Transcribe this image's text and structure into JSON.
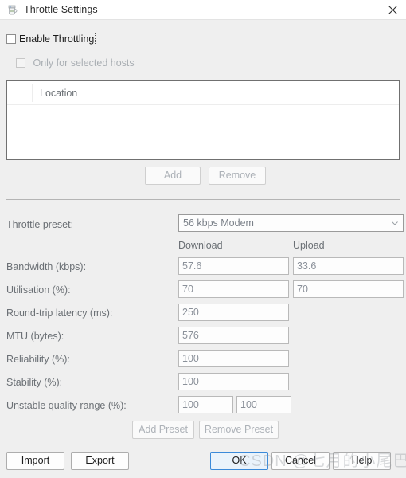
{
  "window": {
    "title": "Throttle Settings",
    "icon": "throttle-jug-icon",
    "close_label": "✕"
  },
  "options": {
    "enable_throttling": {
      "label": "Enable Throttling",
      "checked": false,
      "focused": true
    },
    "only_selected_hosts": {
      "label": "Only for selected hosts",
      "checked": false,
      "disabled": true
    }
  },
  "hosts_table": {
    "columns": [
      "",
      "Location"
    ],
    "rows": [],
    "buttons": {
      "add": "Add",
      "remove": "Remove"
    }
  },
  "preset": {
    "label": "Throttle preset:",
    "value": "56 kbps Modem",
    "options": [
      "56 kbps Modem"
    ]
  },
  "columns": {
    "download": "Download",
    "upload": "Upload"
  },
  "settings": [
    {
      "label": "Bandwidth (kbps):",
      "download": "57.6",
      "upload": "33.6"
    },
    {
      "label": "Utilisation (%):",
      "download": "70",
      "upload": "70"
    },
    {
      "label": "Round-trip latency (ms):",
      "download": "250",
      "upload": null
    },
    {
      "label": "MTU (bytes):",
      "download": "576",
      "upload": null
    },
    {
      "label": "Reliability (%):",
      "download": "100",
      "upload": null
    },
    {
      "label": "Stability (%):",
      "download": "100",
      "upload": null
    }
  ],
  "unstable_range": {
    "label": "Unstable quality range (%):",
    "min": "100",
    "max": "100"
  },
  "preset_buttons": {
    "add": "Add Preset",
    "remove": "Remove Preset"
  },
  "footer": {
    "import": "Import",
    "export": "Export",
    "ok": "OK",
    "cancel": "Cancel",
    "help": "Help"
  },
  "watermark": "CSDN @七月的小尾巴",
  "colors": {
    "dialog_bg": "#efefef",
    "titlebar_bg": "#ffffff",
    "accent": "#3b8ad9",
    "label_text": "#6b7075",
    "field_text": "#8a9099"
  }
}
